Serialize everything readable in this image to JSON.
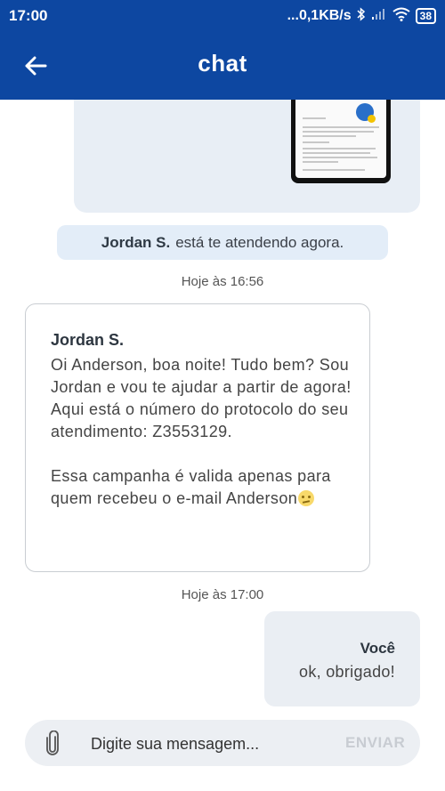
{
  "status_bar": {
    "time": "17:00",
    "network_speed": "...0,1KB/s",
    "battery": "38"
  },
  "header": {
    "title": "chat",
    "back_icon": "arrow-left-icon"
  },
  "chat": {
    "attendance_notice": {
      "agent_name": "Jordan S.",
      "text": "está te atendendo agora."
    },
    "timestamp_1": "Hoje às 16:56",
    "agent_message": {
      "sender": "Jordan S.",
      "paragraph_1": "Oi Anderson, boa noite! Tudo bem? Sou Jordan e vou te ajudar a partir de agora! Aqui está o número do protocolo do seu atendimento: Z3553129.",
      "paragraph_2": "Essa campanha é valida apenas para quem recebeu o e-mail Anderson"
    },
    "timestamp_2": "Hoje às 17:00",
    "user_message": {
      "sender": "Você",
      "text": "ok, obrigado!"
    }
  },
  "composer": {
    "placeholder": "Digite sua mensagem...",
    "send_label": "ENVIAR",
    "attach_icon": "paperclip-icon"
  },
  "colors": {
    "brand_blue": "#0d47a1",
    "notice_bg": "#e3edf8",
    "user_bubble_bg": "#eaeef3",
    "input_bg": "#eceff3"
  }
}
